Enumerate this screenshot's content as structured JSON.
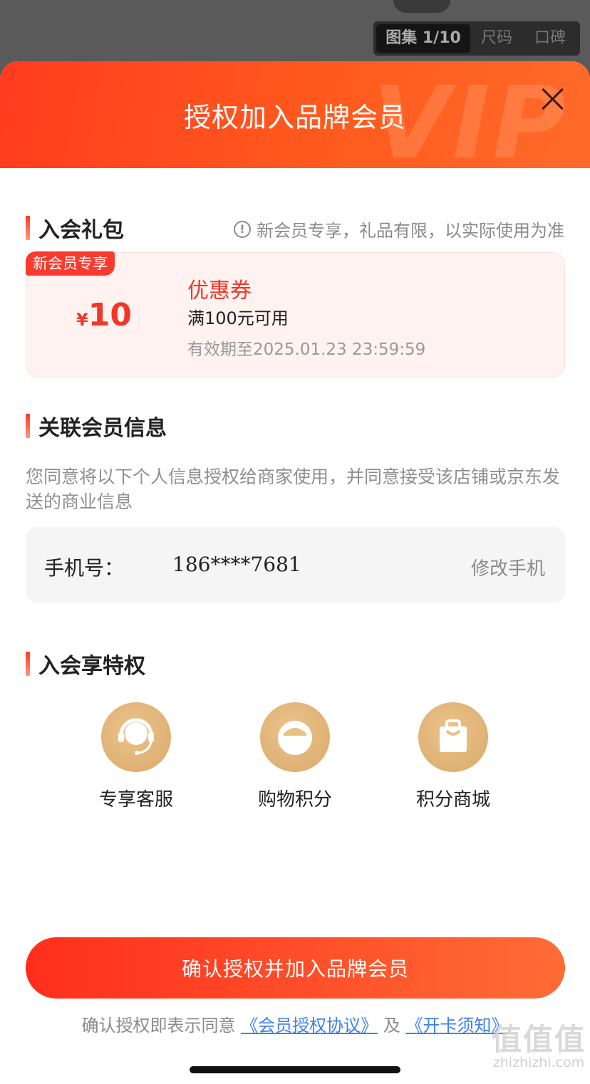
{
  "gallery": {
    "tabs": [
      "图集 1/10",
      "尺码",
      "口碑"
    ]
  },
  "sheet": {
    "title": "授权加入品牌会员",
    "watermark": "VIP"
  },
  "gift": {
    "heading": "入会礼包",
    "note": "新会员专享，礼品有限，以实际使用为准",
    "coupon": {
      "badge": "新会员专享",
      "currency": "¥",
      "amount": "10",
      "type": "优惠券",
      "condition": "满100元可用",
      "validity": "有效期至2025.01.23 23:59:59"
    }
  },
  "member": {
    "heading": "关联会员信息",
    "description": "您同意将以下个人信息授权给商家使用，并同意接受该店铺或京东发送的商业信息",
    "phone_label": "手机号：",
    "phone_value": "186****7681",
    "change_label": "修改手机"
  },
  "perks": {
    "heading": "入会享特权",
    "items": [
      {
        "label": "专享客服",
        "icon": "headset-icon"
      },
      {
        "label": "购物积分",
        "icon": "bowl-icon"
      },
      {
        "label": "积分商城",
        "icon": "shopping-bag-icon"
      }
    ]
  },
  "footer": {
    "confirm_label": "确认授权并加入品牌会员",
    "agree_prefix": "确认授权即表示同意",
    "agreement_link": "《会员授权协议》",
    "agree_and": "及",
    "notice_link": "《开卡须知》"
  },
  "watermark": {
    "logo": "值值值",
    "site": "zhizhizhi.com"
  },
  "colors": {
    "accent": "#ff3c1e",
    "gold": "#d9a868",
    "link": "#3e7ff0"
  }
}
